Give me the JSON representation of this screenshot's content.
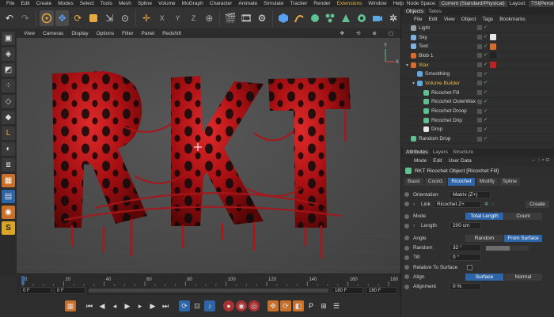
{
  "menu": {
    "items": [
      "File",
      "Edit",
      "Create",
      "Modes",
      "Select",
      "Tools",
      "Mesh",
      "Spline",
      "Volume",
      "MoGraph",
      "Character",
      "Animate",
      "Simulate",
      "Tracker",
      "Render",
      "Extensions",
      "Window",
      "Help"
    ],
    "accent_item": "Extensions",
    "node_space_label": "Node Space:",
    "node_space_value": "Current (Standard/Physical)",
    "layout_label": "Layout:",
    "layout_value": "TSI|PercentRecom"
  },
  "viewport": {
    "menu": [
      "View",
      "Cameras",
      "Display",
      "Options",
      "Filter",
      "Panel",
      "Redshift"
    ],
    "axis_y": "Y",
    "axis_x": "X"
  },
  "timeline": {
    "ticks": [
      "0",
      "20",
      "40",
      "60",
      "80",
      "100",
      "120",
      "140",
      "160",
      "180"
    ],
    "start_frame": "0 F",
    "current_frame": "0 F",
    "end_frame": "180 F",
    "max_frame": "180 F"
  },
  "objects": {
    "tabs": [
      "Objects",
      "Takes"
    ],
    "menu": [
      "File",
      "Edit",
      "View",
      "Object",
      "Tags",
      "Bookmarks"
    ],
    "rows": [
      {
        "name": "Light",
        "indent": 0,
        "color": "#9aa0a8",
        "tag": ""
      },
      {
        "name": "Sky",
        "indent": 0,
        "color": "#7fb0e0",
        "tag": "#e8e8e8"
      },
      {
        "name": "Text",
        "indent": 0,
        "color": "#7fb0e0",
        "tag": "#d96b2c"
      },
      {
        "name": "Blob 1",
        "indent": 0,
        "color": "#d96b2c",
        "tag": "#222"
      },
      {
        "name": "Wax",
        "indent": 0,
        "color": "#d96b2c",
        "tag": "#c02020",
        "selected": true
      },
      {
        "name": "Smoothing",
        "indent": 1,
        "color": "#5fa8e0",
        "tag": ""
      },
      {
        "name": "Volume Builder",
        "indent": 1,
        "color": "#5fa8e0",
        "tag": "",
        "selected": true
      },
      {
        "name": "Ricochet Fill",
        "indent": 2,
        "color": "#5fc090",
        "tag": ""
      },
      {
        "name": "Ricochet OuterWax",
        "indent": 2,
        "color": "#5fc090",
        "tag": ""
      },
      {
        "name": "Ricochet Droop",
        "indent": 2,
        "color": "#5fc090",
        "tag": ""
      },
      {
        "name": "Ricochet Drip",
        "indent": 2,
        "color": "#5fc090",
        "tag": ""
      },
      {
        "name": "Drop",
        "indent": 2,
        "color": "#e8e8e8",
        "tag": ""
      },
      {
        "name": "Random Drop",
        "indent": 0,
        "color": "#5fc090",
        "tag": ""
      }
    ]
  },
  "attributes": {
    "tabs": [
      "Attributes",
      "Layers",
      "Structure"
    ],
    "menu": [
      "Mode",
      "Edit",
      "User Data"
    ],
    "object_title": "RKT Ricochet Object [Ricochet Fill]",
    "subtabs": [
      "Basic",
      "Coord.",
      "Ricochet",
      "Modify",
      "Spline"
    ],
    "active_subtab": "Ricochet",
    "orientation_label": "Orientation",
    "orientation_value": "Matrix (Z+)",
    "link_label": "Link",
    "link_value": "Ricochet Z+",
    "create_label": "Create",
    "mode_label": "Mode",
    "mode_options": [
      "Total Length",
      "Count"
    ],
    "length_label": "Length",
    "length_value": "200 cm",
    "angle_label": "Angle",
    "angle_options": [
      "Random",
      "From Surface"
    ],
    "random_label": "Random",
    "random_value": "32 °",
    "random_level": 0.55,
    "tilt_label": "Tilt",
    "tilt_value": "0 °",
    "relative_label": "Relative To Surface",
    "align_label": "Align",
    "align_options": [
      "Surface",
      "Normal"
    ],
    "alignment_label": "Alignment",
    "alignment_value": "0 %"
  }
}
